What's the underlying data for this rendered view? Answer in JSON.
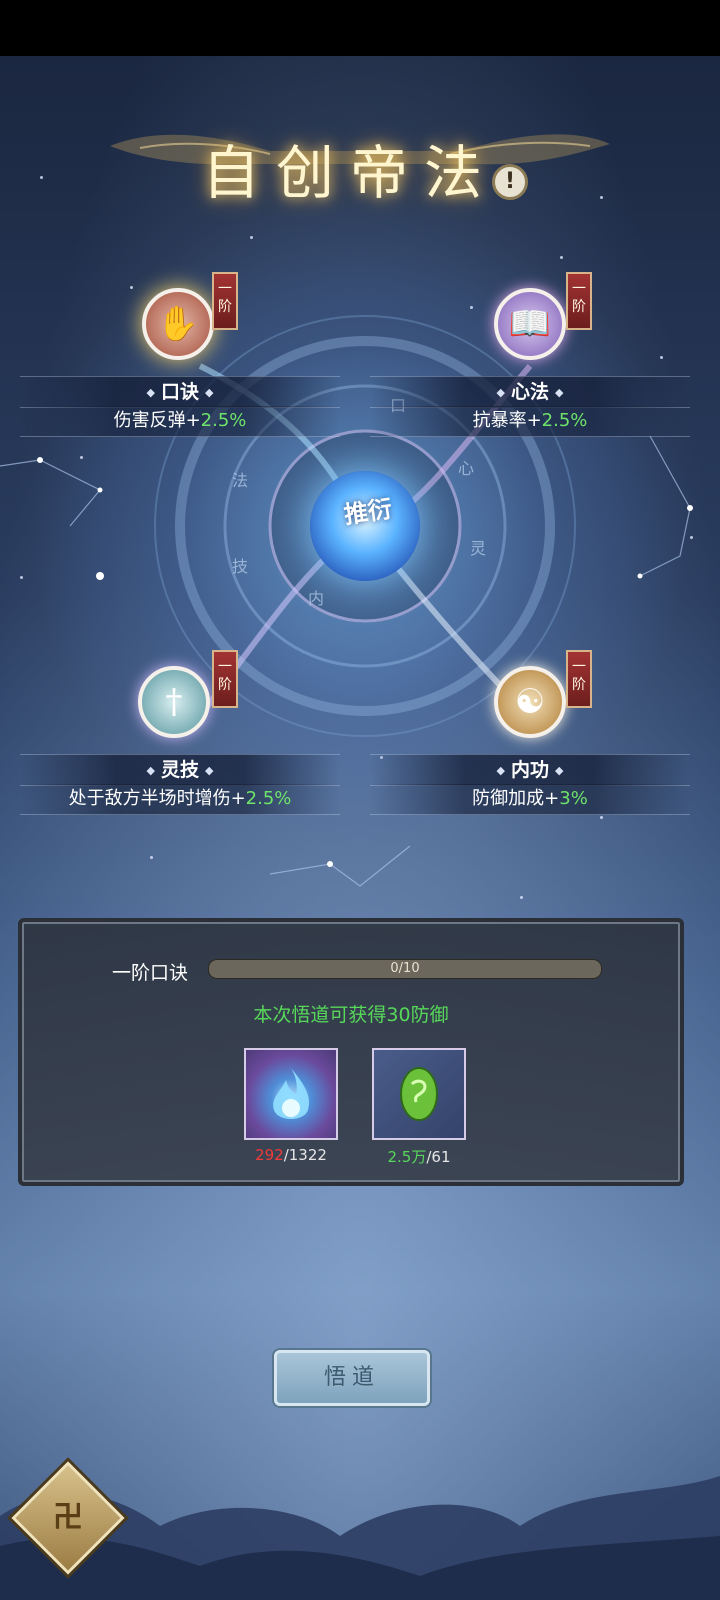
{
  "header": {
    "title": "自创帝法",
    "info_glyph": "!"
  },
  "core": {
    "label": "推衍"
  },
  "nodes": {
    "koujue": {
      "rank": "一阶",
      "name": "口诀",
      "effect_text": "伤害反弹+",
      "effect_value": "2.5%",
      "color": "#c98a78"
    },
    "xinfa": {
      "rank": "一阶",
      "name": "心法",
      "effect_text": "抗暴率+",
      "effect_value": "2.5%",
      "color": "#9b86c9"
    },
    "lingji": {
      "rank": "一阶",
      "name": "灵技",
      "effect_text": "处于敌方半场时增伤+",
      "effect_value": "2.5%",
      "color": "#7fb4b8"
    },
    "neigong": {
      "rank": "一阶",
      "name": "内功",
      "effect_text": "防御加成+",
      "effect_value": "3%",
      "color": "#c9a36b"
    }
  },
  "panel": {
    "progress_label": "一阶口诀",
    "progress_current": 0,
    "progress_max": 10,
    "progress_text": "0/10",
    "reward_text": "本次悟道可获得30防御",
    "items": [
      {
        "icon": "blue-flame-icon",
        "have": "292",
        "need": "/1322"
      },
      {
        "icon": "green-jade-icon",
        "have": "2.5万",
        "need": "/61"
      }
    ]
  },
  "buttons": {
    "wudao": "悟道",
    "corner_glyph": "卍"
  },
  "colors": {
    "positive": "#6ee36a",
    "insufficient": "#ee3b3b",
    "accent_gold": "#f2c96a"
  }
}
